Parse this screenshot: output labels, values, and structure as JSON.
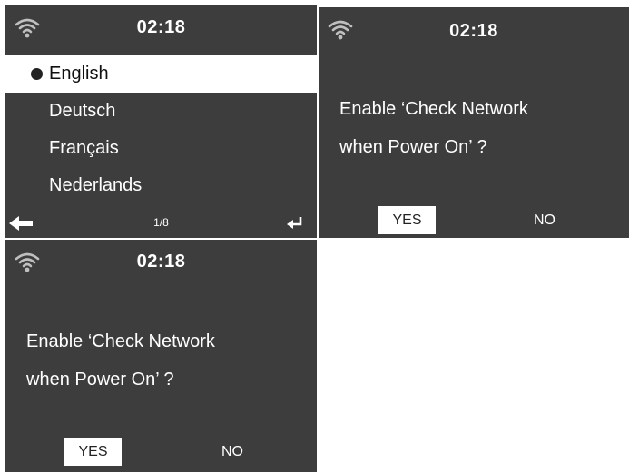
{
  "language_screen": {
    "time": "02:18",
    "languages": [
      {
        "label": "English",
        "selected": true
      },
      {
        "label": "Deutsch",
        "selected": false
      },
      {
        "label": "Français",
        "selected": false
      },
      {
        "label": "Nederlands",
        "selected": false
      }
    ],
    "page_indicator": "1/8",
    "icons": {
      "status": "wifi-icon",
      "back": "back-arrow-icon",
      "confirm": "enter-icon"
    }
  },
  "network_screens": [
    {
      "time": "02:18",
      "prompt_line1": "Enable ‘Check Network",
      "prompt_line2": "when Power On’ ?",
      "yes_label": "YES",
      "no_label": "NO",
      "highlighted": "YES"
    },
    {
      "time": "02:18",
      "prompt_line1": "Enable ‘Check Network",
      "prompt_line2": "when Power On’ ?",
      "yes_label": "YES",
      "no_label": "NO",
      "highlighted": "YES"
    }
  ],
  "colors": {
    "screen_background": "#3d3d3d",
    "text": "#ffffff",
    "highlight_background": "#ffffff",
    "highlight_text": "#111111"
  }
}
